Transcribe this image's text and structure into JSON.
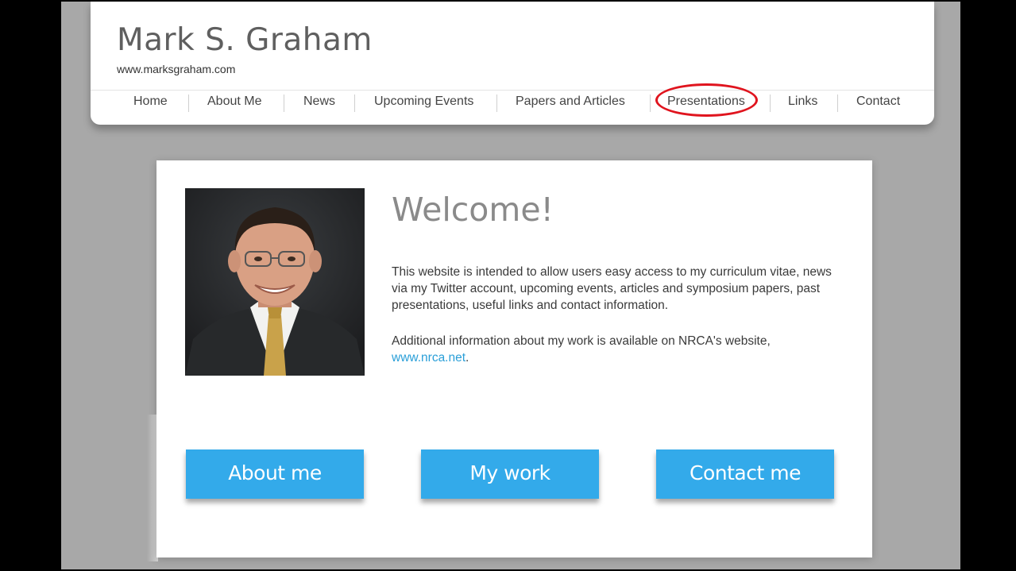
{
  "site": {
    "title": "Mark S. Graham",
    "url": "www.marksgraham.com"
  },
  "nav": {
    "items": [
      {
        "label": "Home"
      },
      {
        "label": "About Me"
      },
      {
        "label": "News"
      },
      {
        "label": "Upcoming Events"
      },
      {
        "label": "Papers and Articles"
      },
      {
        "label": "Presentations",
        "highlighted": true
      },
      {
        "label": "Links"
      },
      {
        "label": "Contact"
      }
    ],
    "highlight_color": "#e0141e"
  },
  "welcome": {
    "heading": "Welcome!",
    "paragraph1": "This website is intended to allow users easy access to my curriculum vitae, news via my Twitter account, upcoming events, articles and symposium papers, past presentations, useful links and contact information.",
    "paragraph2_text": "Additional information about my work is available on NRCA's website,",
    "paragraph2_link": "www.nrca.net",
    "paragraph2_end": "."
  },
  "buttons": {
    "about": "About me",
    "work": "My work",
    "contact": "Contact me",
    "color": "#33aaea"
  }
}
